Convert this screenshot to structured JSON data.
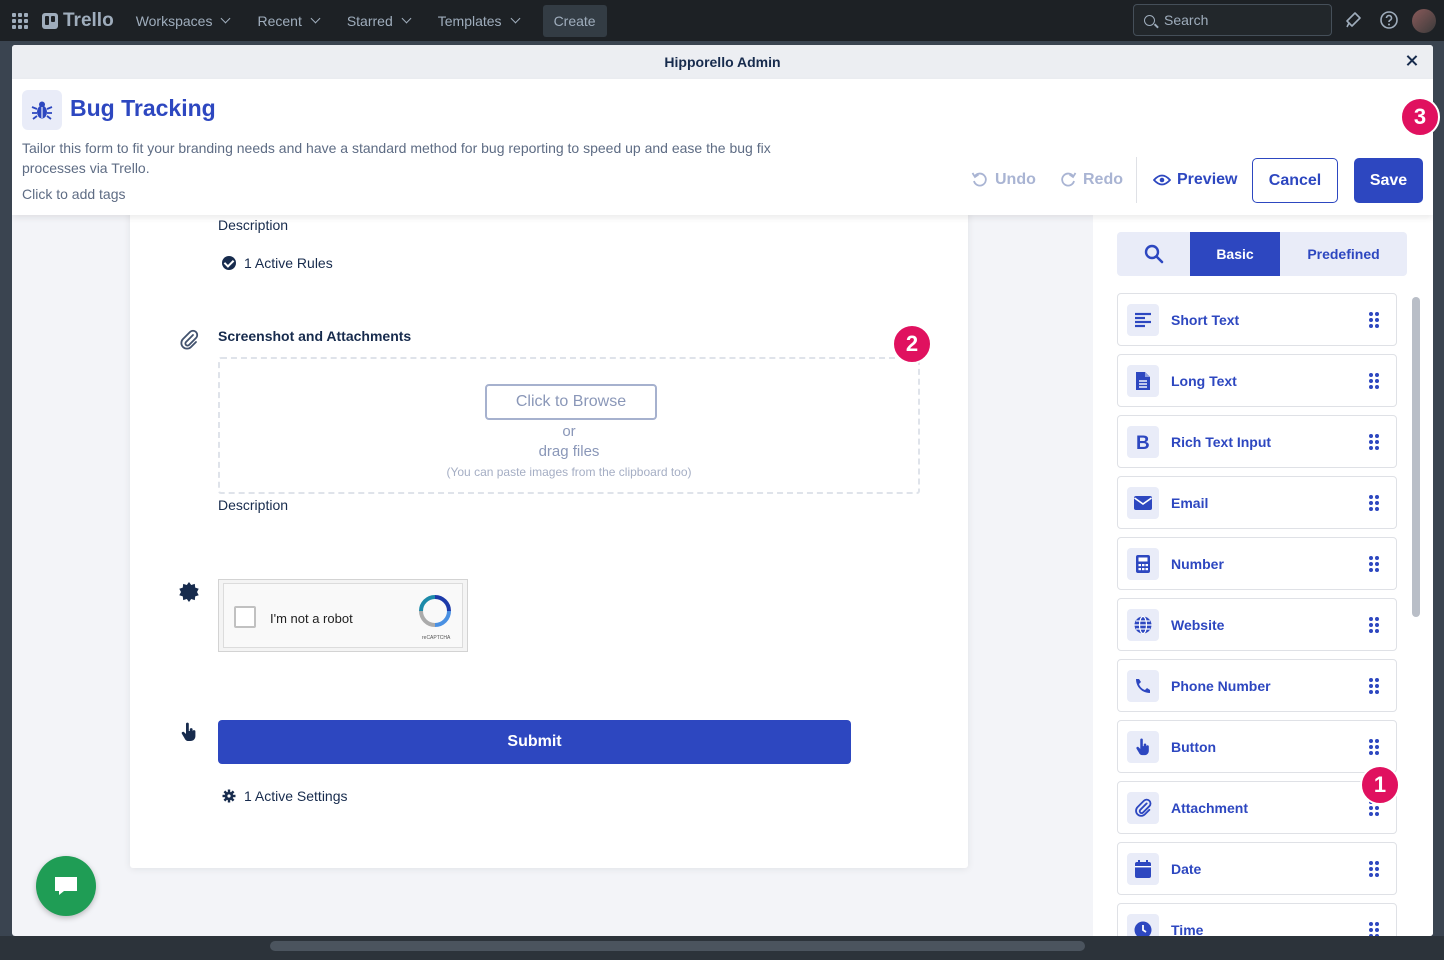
{
  "topnav": {
    "logo": "Trello",
    "menu": [
      "Workspaces",
      "Recent",
      "Starred",
      "Templates"
    ],
    "create": "Create",
    "search_placeholder": "Search"
  },
  "modal": {
    "title": "Hipporello Admin"
  },
  "form": {
    "title": "Bug Tracking",
    "description": "Tailor this form to fit your branding needs and have a standard method for bug reporting to speed up and ease the bug fix processes via Trello.",
    "tags": "Click to add tags",
    "undo": "Undo",
    "redo": "Redo",
    "preview": "Preview",
    "cancel": "Cancel",
    "save": "Save"
  },
  "canvas": {
    "description_label_1": "Description",
    "active_rules": "1 Active Rules",
    "attachment_field_title": "Screenshot and Attachments",
    "browse_button": "Click to Browse",
    "or_text": "or",
    "drag_text": "drag files",
    "paste_hint": "(You can paste images from the clipboard too)",
    "description_label_2": "Description",
    "recaptcha_label": "I'm not a robot",
    "recaptcha_brand": "reCAPTCHA",
    "submit_button": "Submit",
    "active_settings": "1 Active Settings"
  },
  "badges": [
    "1",
    "2",
    "3"
  ],
  "panel": {
    "tabs": [
      "Basic",
      "Predefined"
    ],
    "active_tab": "Basic",
    "items": [
      {
        "label": "Short Text",
        "icon": "align-left-icon"
      },
      {
        "label": "Long Text",
        "icon": "document-icon"
      },
      {
        "label": "Rich Text Input",
        "icon": "bold-icon"
      },
      {
        "label": "Email",
        "icon": "envelope-icon"
      },
      {
        "label": "Number",
        "icon": "calculator-icon"
      },
      {
        "label": "Website",
        "icon": "globe-icon"
      },
      {
        "label": "Phone Number",
        "icon": "phone-icon"
      },
      {
        "label": "Button",
        "icon": "pointer-hand-icon"
      },
      {
        "label": "Attachment",
        "icon": "paperclip-icon"
      },
      {
        "label": "Date",
        "icon": "calendar-icon"
      },
      {
        "label": "Time",
        "icon": "clock-icon"
      }
    ]
  },
  "colors": {
    "primary": "#2d47c0",
    "badge": "#e0115f",
    "chat": "#1f9d55"
  }
}
